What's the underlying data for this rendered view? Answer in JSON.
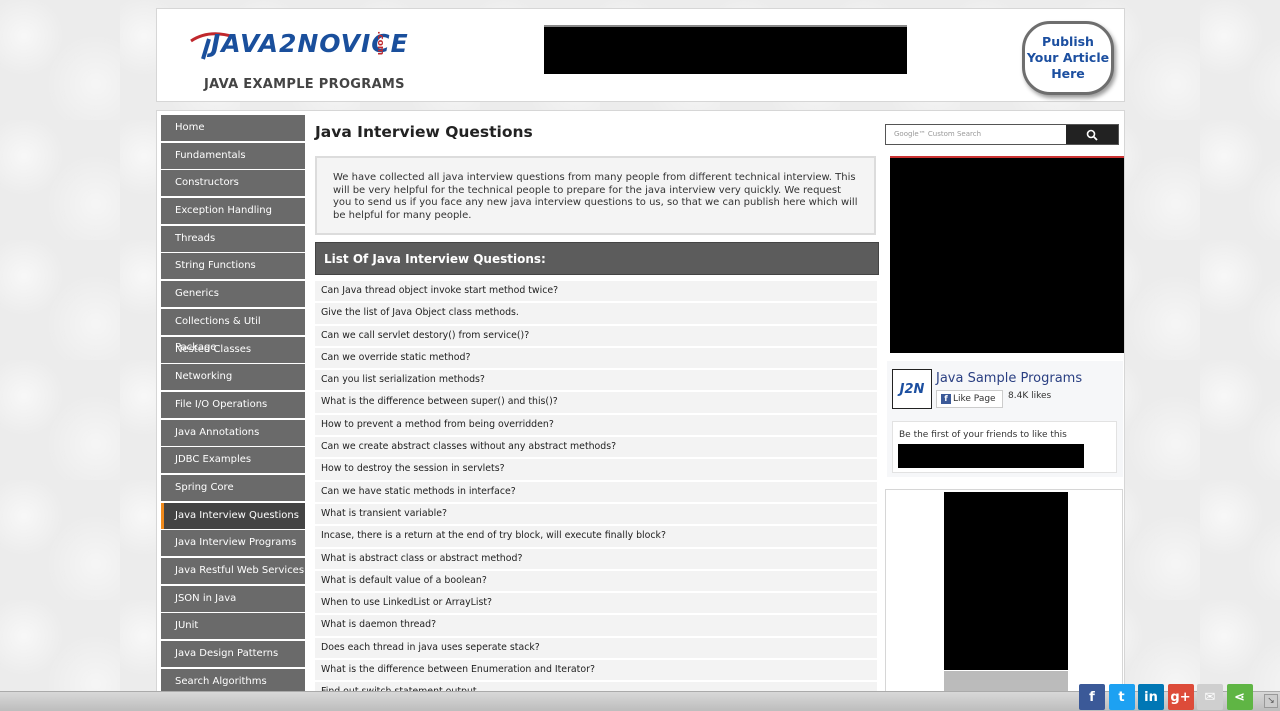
{
  "header": {
    "logo_text": "JAVA2NOVICE",
    "logo_suffix": ".com",
    "tagline": "JAVA EXAMPLE PROGRAMS",
    "publish_lines": [
      "Publish",
      "Your Article",
      "Here"
    ]
  },
  "nav": {
    "items": [
      "Home",
      "Fundamentals",
      "Constructors",
      "Exception Handling",
      "Threads",
      "String Functions",
      "Generics",
      "Collections & Util Package",
      "Nested Classes",
      "Networking",
      "File I/O Operations",
      "Java Annotations",
      "JDBC Examples",
      "Spring Core",
      "Java Interview Questions",
      "Java Interview Programs",
      "Java Restful Web Services",
      "JSON in Java",
      "JUnit",
      "Java Design Patterns",
      "Search Algorithms"
    ],
    "active": "Java Interview Questions"
  },
  "main": {
    "title": "Java Interview Questions",
    "intro": "We have collected all java interview questions from many people from different technical interview. This will be very helpful for the technical people to prepare for the java interview very quickly. We request you to send us if you face any new java interview questions to us, so that we can publish here which will be helpful for many people.",
    "list_header": "List Of Java Interview Questions:",
    "questions": [
      "Can Java thread object invoke start method twice?",
      "Give the list of Java Object class methods.",
      "Can we call servlet destory() from service()?",
      "Can we override static method?",
      "Can you list serialization methods?",
      "What is the difference between super() and this()?",
      "How to prevent a method from being overridden?",
      "Can we create abstract classes without any abstract methods?",
      "How to destroy the session in servlets?",
      "Can we have static methods in interface?",
      "What is transient variable?",
      "Incase, there is a return at the end of try block, will execute finally block?",
      "What is abstract class or abstract method?",
      "What is default value of a boolean?",
      "When to use LinkedList or ArrayList?",
      "What is daemon thread?",
      "Does each thread in java uses seperate stack?",
      "What is the difference between Enumeration and Iterator?",
      "Find out switch statement output."
    ]
  },
  "sidebar": {
    "search_placeholder": "Google™ Custom Search",
    "fb": {
      "logo": "J2N",
      "page_name": "Java Sample Programs",
      "like_label": "Like Page",
      "likes": "8.4K likes",
      "friends_text": "Be the first of your friends to like this"
    }
  },
  "share": {
    "icons": [
      {
        "name": "facebook-icon",
        "glyph": "f",
        "color": "#3b5998"
      },
      {
        "name": "twitter-icon",
        "glyph": "t",
        "color": "#1da1f2"
      },
      {
        "name": "linkedin-icon",
        "glyph": "in",
        "color": "#0077b5"
      },
      {
        "name": "google-plus-icon",
        "glyph": "g+",
        "color": "#dd4b39"
      },
      {
        "name": "email-icon",
        "glyph": "✉",
        "color": "#cfcfcf"
      },
      {
        "name": "share-icon",
        "glyph": "⋖",
        "color": "#5fb544"
      }
    ]
  }
}
